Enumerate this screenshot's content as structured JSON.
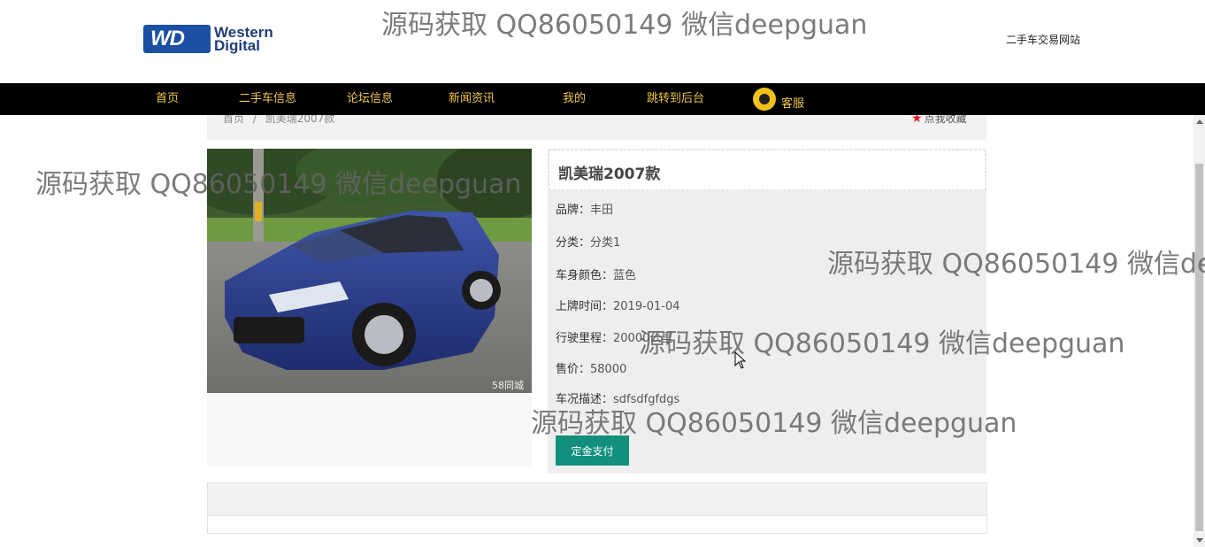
{
  "header": {
    "logo_line1": "Western",
    "logo_line2": "Digital",
    "logo_badge": "WD",
    "site_name": "二手车交易网站"
  },
  "nav": {
    "items": [
      "首页",
      "二手车信息",
      "论坛信息",
      "新闻资讯",
      "我的",
      "跳转到后台"
    ],
    "kefu_label": "客服"
  },
  "breadcrumb": {
    "home": "首页",
    "sep": "/",
    "current": "凯美瑞2007款",
    "favorite": "点我收藏"
  },
  "car": {
    "title": "凯美瑞2007款",
    "photo_watermark": "58同城",
    "fields": [
      {
        "label": "品牌：",
        "value": "丰田"
      },
      {
        "label": "分类：",
        "value": "分类1"
      },
      {
        "label": "车身颜色：",
        "value": "蓝色"
      },
      {
        "label": "上牌时间：",
        "value": "2019-01-04"
      },
      {
        "label": "行驶里程：",
        "value": "20000公里"
      },
      {
        "label": "售价：",
        "value": "58000"
      },
      {
        "label": "车况描述：",
        "value": "sdfsdfgfdgs"
      }
    ],
    "pay_button": "定金支付"
  },
  "watermark_text": "源码获取 QQ86050149 微信deepguan",
  "colors": {
    "nav_bg": "#000000",
    "nav_text": "#f0c64a",
    "button": "#12907d",
    "favorite_star": "#e01b1b"
  }
}
